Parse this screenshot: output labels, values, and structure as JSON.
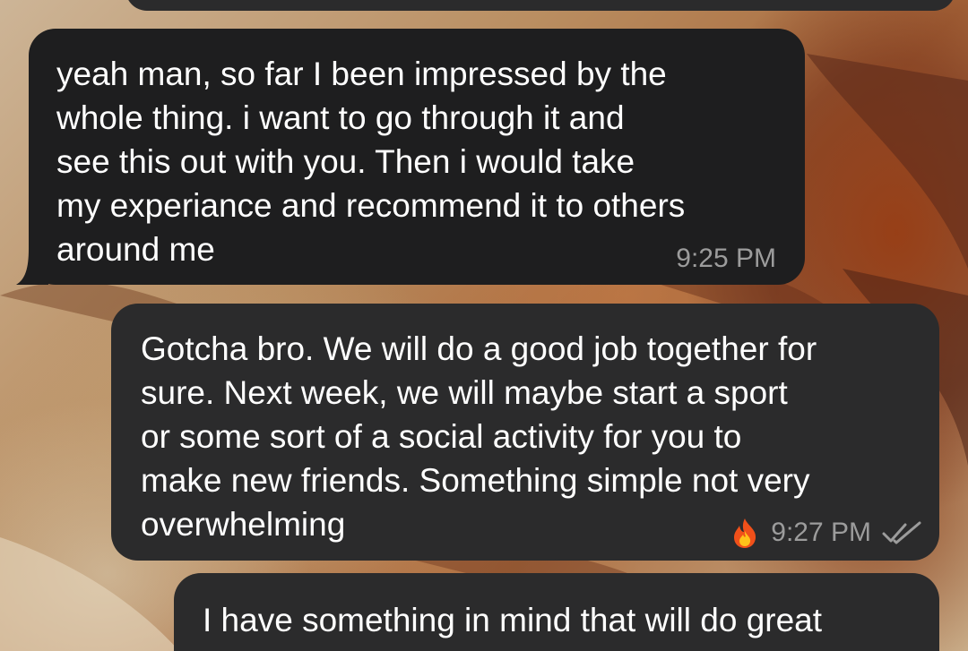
{
  "messages": [
    {
      "direction": "incoming",
      "text": "yeah man, so far I been impressed by the\nwhole thing. i want to go through it and\nsee this out with you. Then i would take\nmy experiance and recommend it to others\naround me",
      "time": "9:25 PM"
    },
    {
      "direction": "outgoing",
      "text": "Gotcha bro. We will do a good job together for\nsure. Next week, we will maybe start a sport\nor some sort of a social activity for you to\nmake new friends. Something simple not very\noverwhelming",
      "time": "9:27 PM",
      "reaction_icon": "fire-icon",
      "status_icon": "double-check-icon"
    },
    {
      "direction": "outgoing",
      "text": "I have something in mind that will do great"
    }
  ],
  "colors": {
    "incoming_bubble": "#1e1e1f",
    "outgoing_bubble": "#2b2b2c",
    "message_text": "#ffffff",
    "meta_text": "#9c9c9c"
  }
}
